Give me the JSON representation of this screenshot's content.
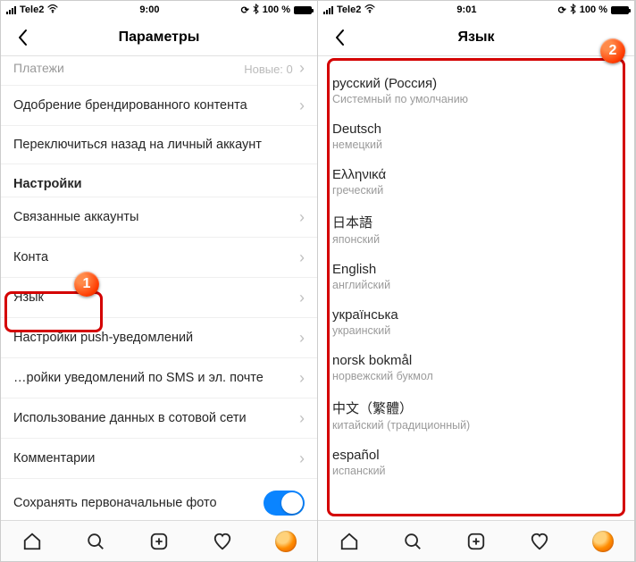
{
  "left": {
    "status": {
      "carrier": "Tele2",
      "time": "9:00",
      "batt": "100 %"
    },
    "nav": {
      "title": "Параметры"
    },
    "rows": {
      "payments": "Платежи",
      "payments_meta": "Новые: 0",
      "branded": "Одобрение брендированного контента",
      "switchback": "Переключиться назад на личный аккаунт",
      "section": "Настройки",
      "linked": "Связанные аккаунты",
      "contacts": "Конта",
      "language": "Язык",
      "push": "Настройки push-уведомлений",
      "sms": "…ройки уведомлений по SMS и эл. почте",
      "cellular": "Использование данных в сотовой сети",
      "comments": "Комментарии",
      "savephotos": "Сохранять первоначальные фото"
    },
    "badge": "1"
  },
  "right": {
    "status": {
      "carrier": "Tele2",
      "time": "9:01",
      "batt": "100 %"
    },
    "nav": {
      "title": "Язык"
    },
    "langs": [
      {
        "native": "русский (Россия)",
        "sub": "Системный по умолчанию"
      },
      {
        "native": "Deutsch",
        "sub": "немецкий"
      },
      {
        "native": "Ελληνικά",
        "sub": "греческий"
      },
      {
        "native": "日本語",
        "sub": "японский"
      },
      {
        "native": "English",
        "sub": "английский"
      },
      {
        "native": "українська",
        "sub": "украинский"
      },
      {
        "native": "norsk bokmål",
        "sub": "норвежский букмол"
      },
      {
        "native": "中文（繁體）",
        "sub": "китайский (традиционный)"
      },
      {
        "native": "español",
        "sub": "испанский"
      }
    ],
    "badge": "2"
  }
}
